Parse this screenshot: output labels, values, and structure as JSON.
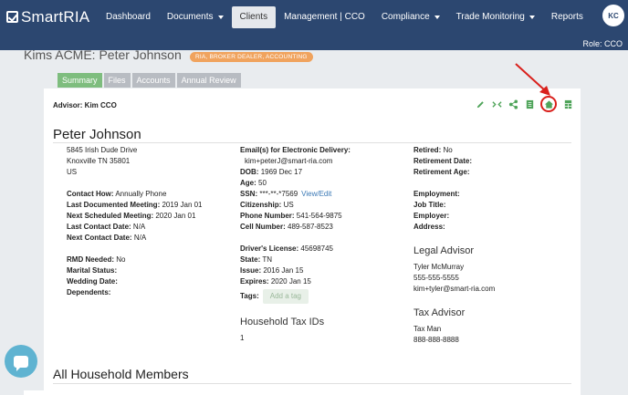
{
  "navbar": {
    "brand": "SmartRIA",
    "items": [
      {
        "label": "Dashboard",
        "dropdown": false,
        "active": false
      },
      {
        "label": "Documents",
        "dropdown": true,
        "active": false
      },
      {
        "label": "Clients",
        "dropdown": false,
        "active": true
      },
      {
        "label": "Management | CCO",
        "dropdown": false,
        "active": false
      },
      {
        "label": "Compliance",
        "dropdown": true,
        "active": false
      },
      {
        "label": "Trade Monitoring",
        "dropdown": true,
        "active": false
      },
      {
        "label": "Reports",
        "dropdown": false,
        "active": false
      }
    ],
    "avatar_initials": "KC",
    "role": "Role: CCO"
  },
  "client": {
    "title": "Kims ACME: Peter Johnson",
    "badge": "RIA, BROKER DEALER, ACCOUNTING"
  },
  "tabs": [
    "Summary",
    "Files",
    "Accounts",
    "Annual Review"
  ],
  "card": {
    "advisor": "Advisor: Kim CCO",
    "toolbar_icons": [
      "pencil-icon",
      "code-icon",
      "share-icon",
      "document-icon",
      "home-icon",
      "spreadsheet-icon"
    ],
    "name": "Peter Johnson",
    "address": [
      "5845 Irish Dude Drive",
      "Knoxville TN 35801",
      "US"
    ],
    "contact": {
      "contact_how_label": "Contact How:",
      "contact_how": "Annually Phone",
      "last_meeting_label": "Last Documented Meeting:",
      "last_meeting": "2019 Jan 01",
      "next_meeting_label": "Next Scheduled Meeting:",
      "next_meeting": "2020 Jan 01",
      "last_contact_label": "Last Contact Date:",
      "last_contact": "N/A",
      "next_contact_label": "Next Contact Date:",
      "next_contact": "N/A"
    },
    "personal": {
      "rmd_label": "RMD Needed:",
      "rmd": "No",
      "marital_label": "Marital Status:",
      "marital": "",
      "wedding_label": "Wedding Date:",
      "wedding": "",
      "dependents_label": "Dependents:",
      "dependents": ""
    },
    "col2": {
      "email_label": "Email(s) for Electronic Delivery:",
      "email": "kim+peterJ@smart-ria.com",
      "dob_label": "DOB:",
      "dob": "1969 Dec 17",
      "age_label": "Age:",
      "age": "50",
      "ssn_label": "SSN:",
      "ssn": "***-**-*7569",
      "ssn_link": "View/Edit",
      "citizenship_label": "Citizenship:",
      "citizenship": "US",
      "phone_label": "Phone Number:",
      "phone": "541-564-9875",
      "cell_label": "Cell Number:",
      "cell": "489-587-8523",
      "license_label": "Driver's License:",
      "license": "45698745",
      "state_label": "State:",
      "state": "TN",
      "issue_label": "Issue:",
      "issue": "2016 Jan 15",
      "expires_label": "Expires:",
      "expires": "2020 Jan 15",
      "tags_label": "Tags:",
      "tag_placeholder": "Add a tag",
      "tax_ids_title": "Household Tax IDs",
      "tax_ids_value": "1"
    },
    "col3": {
      "retired_label": "Retired:",
      "retired": "No",
      "retirement_date_label": "Retirement Date:",
      "retirement_age_label": "Retirement Age:",
      "employment_label": "Employment:",
      "job_title_label": "Job Title:",
      "employer_label": "Employer:",
      "address_label": "Address:",
      "legal_title": "Legal Advisor",
      "legal_name": "Tyler McMurray",
      "legal_phone": "555-555-5555",
      "legal_email": "kim+tyler@smart-ria.com",
      "tax_title": "Tax Advisor",
      "tax_name": "Tax Man",
      "tax_phone": "888-888-8888"
    },
    "household_title": "All Household Members"
  },
  "colors": {
    "navbar": "#2c4770",
    "badge": "#f0a35e",
    "active_tab": "#7ebd7e",
    "icon_green": "#4fa45a",
    "annotation_red": "#d9201c",
    "chat": "#5fb3d1"
  }
}
